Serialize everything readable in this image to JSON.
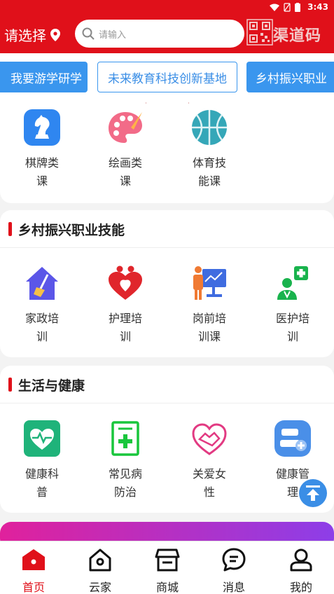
{
  "status": {
    "time": "3:43"
  },
  "header": {
    "location": "请选择",
    "search_placeholder": "请输入",
    "brand": "渠道码"
  },
  "tabs": [
    "我要游学研学",
    "未来教育科技创新基地",
    "乡村振兴职业"
  ],
  "section1": {
    "items": [
      "棋牌类课",
      "绘画类课",
      "体育技能课"
    ]
  },
  "section2": {
    "title": "乡村振兴职业技能",
    "items": [
      "家政培训",
      "护理培训",
      "岗前培训课",
      "医护培训"
    ]
  },
  "section3": {
    "title": "生活与健康",
    "items": [
      "健康科普",
      "常见病防治",
      "关爱女性",
      "健康管理"
    ]
  },
  "bottom_nav": [
    "首页",
    "云家",
    "商城",
    "消息",
    "我的"
  ],
  "colors": {
    "primary": "#e0101a",
    "blue": "#3a96ee"
  }
}
